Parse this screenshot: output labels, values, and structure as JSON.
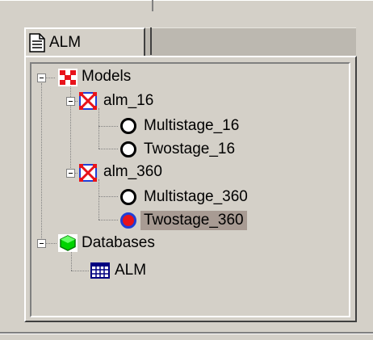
{
  "tab": {
    "label": "ALM",
    "icon": "document-icon"
  },
  "tree": {
    "models": {
      "label": "Models",
      "icon": "models-icon",
      "children": [
        {
          "label": "alm_16",
          "icon": "model-node-icon",
          "children": [
            {
              "label": "Multistage_16",
              "icon": "ring-icon",
              "selected": false
            },
            {
              "label": "Twostage_16",
              "icon": "ring-icon",
              "selected": false
            }
          ]
        },
        {
          "label": "alm_360",
          "icon": "model-node-icon",
          "children": [
            {
              "label": "Multistage_360",
              "icon": "ring-icon",
              "selected": false
            },
            {
              "label": "Twostage_360",
              "icon": "active-ring-icon",
              "selected": true
            }
          ]
        }
      ]
    },
    "databases": {
      "label": "Databases",
      "icon": "database-icon",
      "children": [
        {
          "label": "ALM",
          "icon": "table-icon"
        }
      ]
    }
  },
  "colors": {
    "window_bg": "#d4d0c8",
    "selection_bg": "#a89b93",
    "active_ring_fill": "#e8131a",
    "active_ring_border": "#1f3fd8"
  }
}
